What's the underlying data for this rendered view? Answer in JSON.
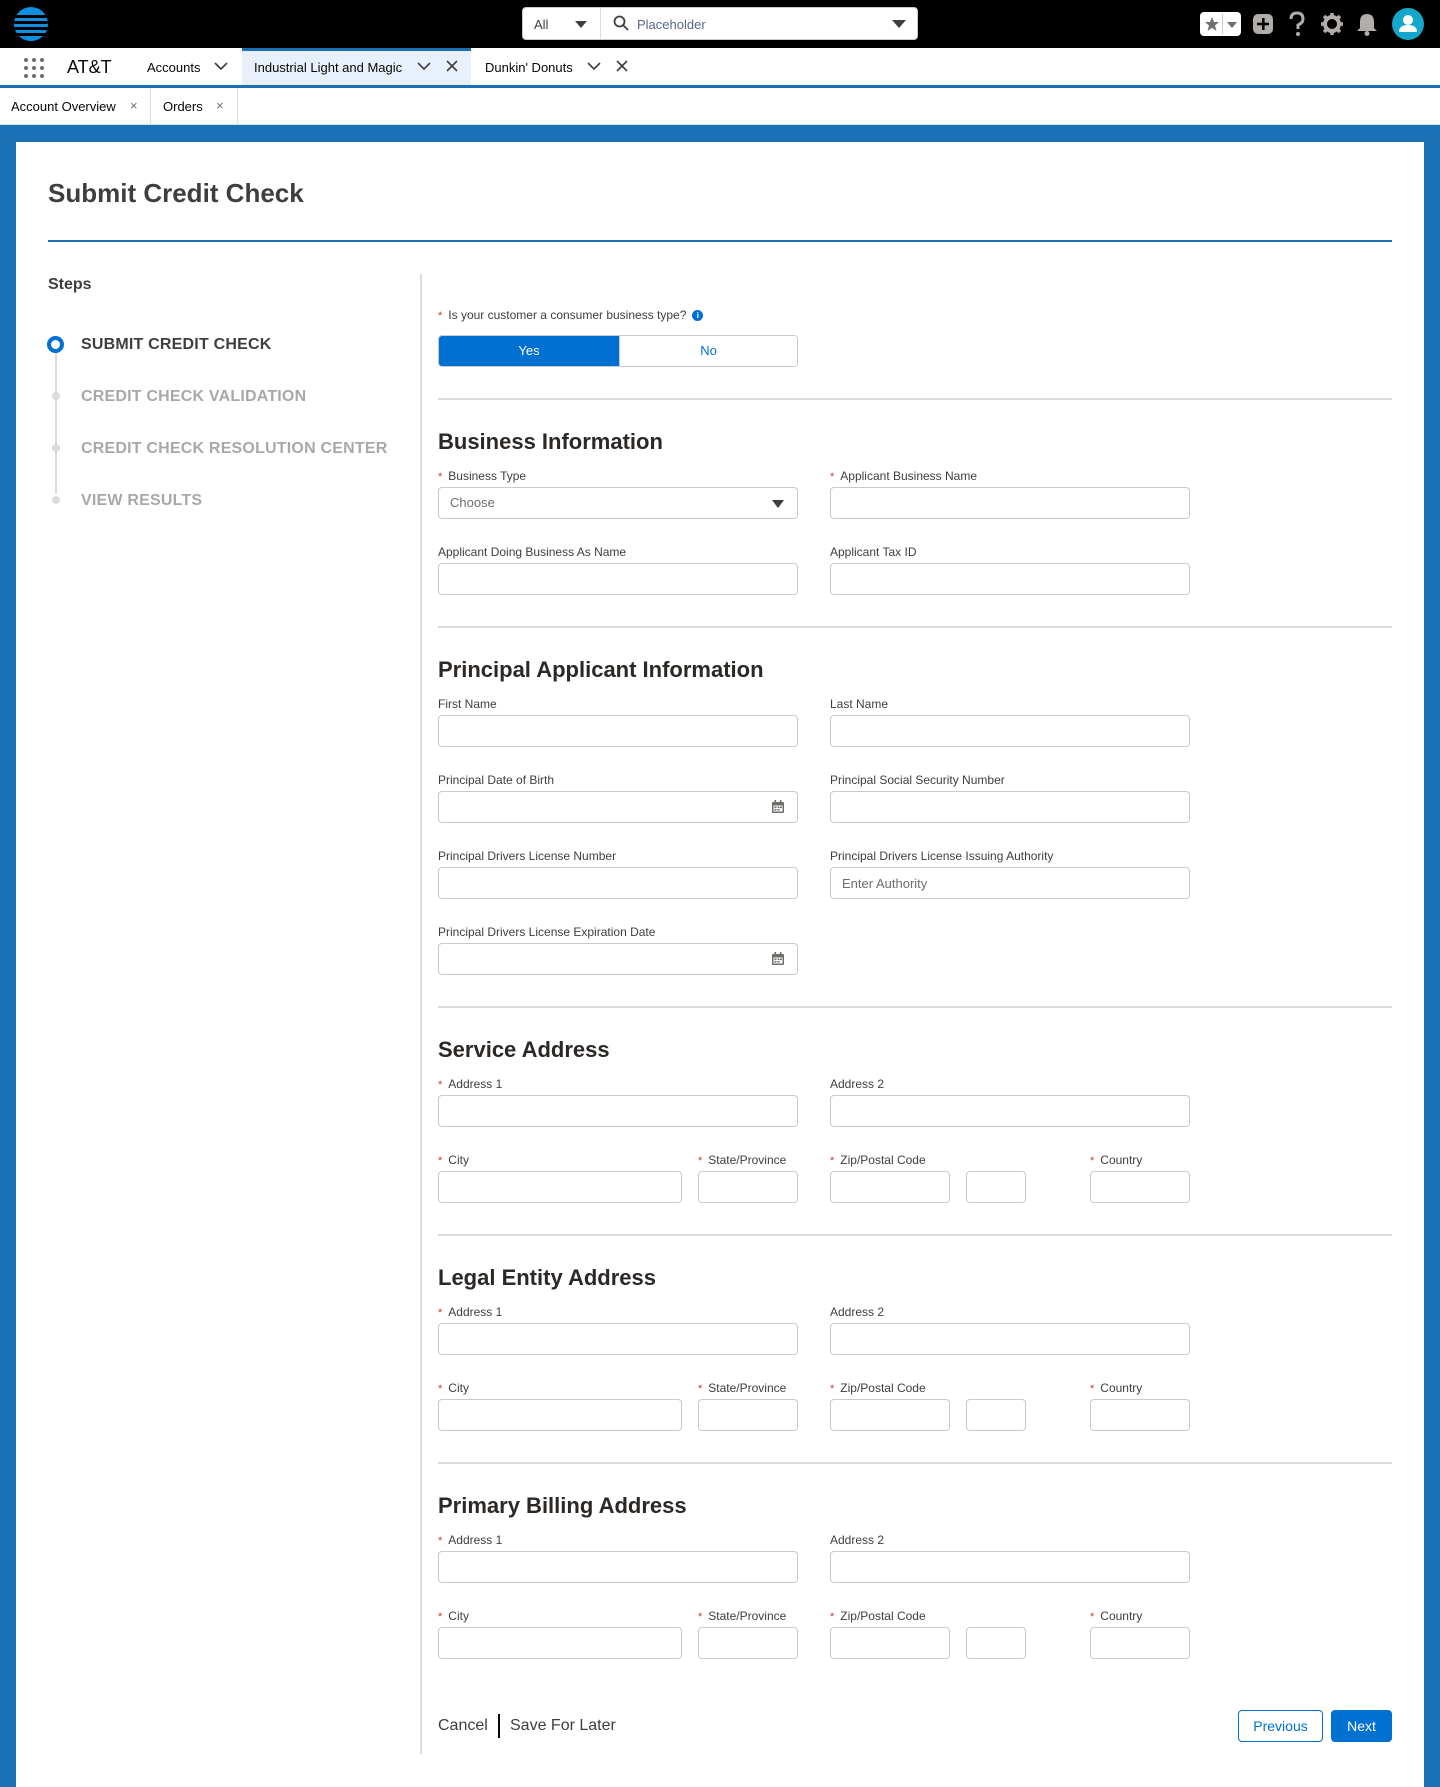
{
  "header": {
    "brand": "AT&T",
    "search_scope": "All",
    "search_placeholder": "Placeholder"
  },
  "nav": {
    "app_name": "AT&T",
    "tabs": [
      {
        "label": "Accounts"
      },
      {
        "label": "Industrial Light and Magic"
      },
      {
        "label": "Dunkin' Donuts"
      }
    ]
  },
  "subtabs": [
    {
      "label": "Account Overview"
    },
    {
      "label": "Orders"
    }
  ],
  "page": {
    "title": "Submit Credit Check",
    "steps_title": "Steps",
    "steps": [
      {
        "label": "SUBMIT CREDIT CHECK",
        "status": "current"
      },
      {
        "label": "CREDIT CHECK VALIDATION",
        "status": "pending"
      },
      {
        "label": "CREDIT CHECK RESOLUTION CENTER",
        "status": "pending"
      },
      {
        "label": "VIEW RESULTS",
        "status": "pending"
      }
    ]
  },
  "question": {
    "label": "Is your customer a consumer business type?",
    "yes": "Yes",
    "no": "No",
    "selected": "Yes"
  },
  "business": {
    "title": "Business Information",
    "type_label": "Business Type",
    "type_value": "Choose",
    "name_label": "Applicant Business Name",
    "dba_label": "Applicant Doing Business As Name",
    "tax_label": "Applicant Tax ID"
  },
  "principal": {
    "title": "Principal Applicant Information",
    "first_label": "First Name",
    "last_label": "Last Name",
    "dob_label": "Principal Date of Birth",
    "ssn_label": "Principal Social Security Number",
    "dl_label": "Principal Drivers License Number",
    "authority_label": "Principal Drivers License Issuing Authority",
    "authority_placeholder": "Enter Authority",
    "exp_label": "Principal Drivers License Expiration Date"
  },
  "address_labels": {
    "address1": "Address 1",
    "address2": "Address 2",
    "city": "City",
    "state": "State/Province",
    "zip": "Zip/Postal Code",
    "country": "Country"
  },
  "sections": {
    "service": "Service Address",
    "legal": "Legal Entity Address",
    "billing": "Primary Billing Address"
  },
  "footer": {
    "cancel": "Cancel",
    "save": "Save For Later",
    "previous": "Previous",
    "next": "Next"
  },
  "colors": {
    "brand_blue": "#1b6fb5",
    "button_blue": "#0070d2",
    "required": "#c23934"
  }
}
